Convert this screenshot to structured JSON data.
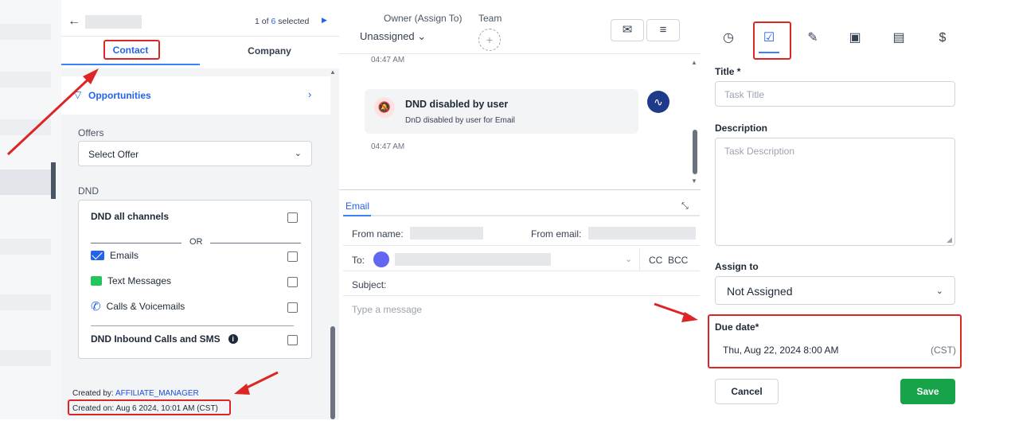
{
  "nav": {
    "back_glyph": "←",
    "counter_prefix": "1 of",
    "counter_total": "6",
    "counter_suffix": "selected"
  },
  "contact_tabs": [
    {
      "label": "Contact"
    },
    {
      "label": "Company"
    }
  ],
  "opportunities": {
    "label": "Opportunities"
  },
  "offers": {
    "label": "Offers",
    "select_value": "Select Offer"
  },
  "dnd": {
    "label": "DND",
    "all_channels": "DND all channels",
    "or_text": "OR",
    "emails": "Emails",
    "text_messages": "Text Messages",
    "calls": "Calls & Voicemails",
    "inbound": "DND Inbound Calls and SMS"
  },
  "meta": {
    "created_by_label": "Created by:",
    "created_by_value": "AFFILIATE_MANAGER",
    "created_on": "Created on: Aug 6 2024, 10:01 AM (CST)"
  },
  "conversation": {
    "owner_label": "Owner (Assign To)",
    "team_label": "Team",
    "owner_value": "Unassigned",
    "time1": "04:47 AM",
    "time2": "04:47 AM",
    "event_title": "DND disabled by user",
    "event_sub": "DnD disabled by user for Email"
  },
  "composer": {
    "tab": "Email",
    "from_name_label": "From name:",
    "from_email_label": "From email:",
    "to_label": "To:",
    "cc": "CC",
    "bcc": "BCC",
    "subject_label": "Subject:",
    "message_placeholder": "Type a message"
  },
  "task": {
    "title_label": "Title *",
    "title_placeholder": "Task Title",
    "desc_label": "Description",
    "desc_placeholder": "Task Description",
    "assign_label": "Assign to",
    "assign_value": "Not Assigned",
    "due_label": "Due date*",
    "due_value": "Thu, Aug 22, 2024 8:00 AM",
    "due_tz": "(CST)",
    "cancel": "Cancel",
    "save": "Save"
  },
  "icons": {
    "tabs": [
      "clock-icon",
      "task-check-icon",
      "pen-icon",
      "calendar-icon",
      "document-icon",
      "dollar-icon"
    ]
  },
  "colors": {
    "accent": "#2563eb",
    "annotation": "#dc2626",
    "save": "#16a34a"
  }
}
